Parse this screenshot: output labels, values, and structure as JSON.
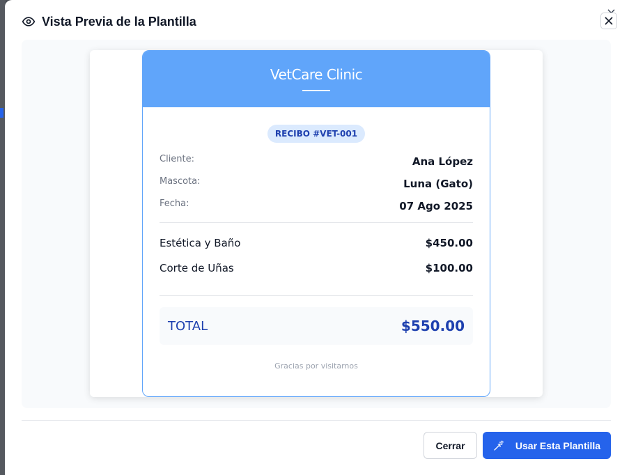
{
  "modal": {
    "title": "Vista Previa de la Plantilla",
    "close_icon": "close-icon",
    "title_icon": "eye-icon"
  },
  "receipt": {
    "clinic_name": "VetCare Clinic",
    "badge": "RECIBO #VET-001",
    "info": [
      {
        "label": "Cliente:",
        "value": "Ana López"
      },
      {
        "label": "Mascota:",
        "value": "Luna (Gato)"
      },
      {
        "label": "Fecha:",
        "value": "07 Ago 2025"
      }
    ],
    "items": [
      {
        "name": "Estética y Baño",
        "price": "$450.00"
      },
      {
        "name": "Corte de Uñas",
        "price": "$100.00"
      }
    ],
    "total_label": "TOTAL",
    "total_value": "$550.00",
    "footer": "Gracias por visitarnos",
    "accent_color": "#60a5fa",
    "total_color": "#1e40af"
  },
  "footer": {
    "close_label": "Cerrar",
    "use_label": "Usar Esta Plantilla",
    "use_icon": "magic-wand-icon",
    "primary_color": "#2563eb"
  }
}
